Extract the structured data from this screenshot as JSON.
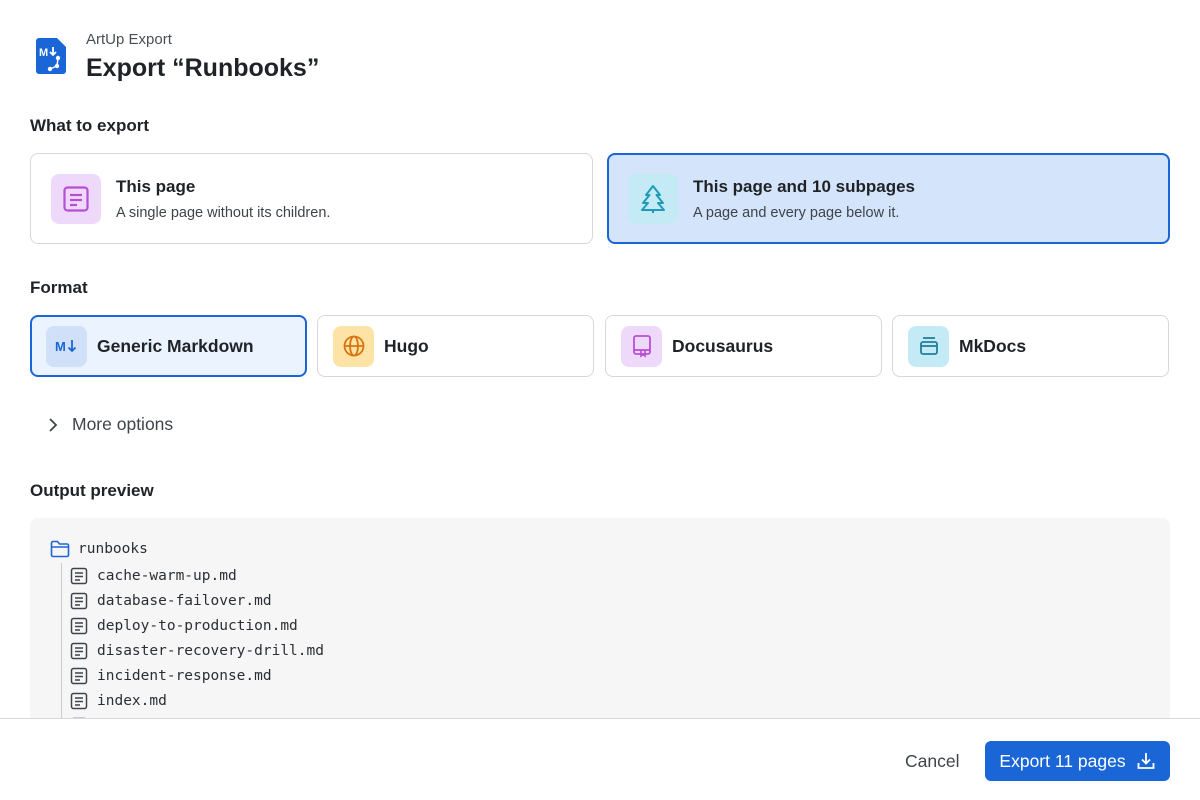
{
  "header": {
    "app_name": "ArtUp Export",
    "title": "Export “Runbooks”"
  },
  "sections": {
    "what_to_export": "What to export",
    "format": "Format",
    "output_preview": "Output preview"
  },
  "scope": {
    "options": [
      {
        "title": "This page",
        "description": "A single page without its children.",
        "icon": "document-icon",
        "selected": false
      },
      {
        "title": "This page and 10 subpages",
        "description": "A page and every page below it.",
        "icon": "tree-icon",
        "selected": true
      }
    ]
  },
  "format": {
    "options": [
      {
        "label": "Generic Markdown",
        "icon": "markdown-icon",
        "selected": true
      },
      {
        "label": "Hugo",
        "icon": "globe-icon",
        "selected": false
      },
      {
        "label": "Docusaurus",
        "icon": "book-icon",
        "selected": false
      },
      {
        "label": "MkDocs",
        "icon": "archive-icon",
        "selected": false
      }
    ]
  },
  "more_options": {
    "label": "More options",
    "expanded": false
  },
  "preview": {
    "root": "runbooks",
    "files": [
      "cache-warm-up.md",
      "database-failover.md",
      "deploy-to-production.md",
      "disaster-recovery-drill.md",
      "incident-response.md",
      "index.md"
    ]
  },
  "footer": {
    "cancel_label": "Cancel",
    "export_label": "Export 11 pages"
  },
  "colors": {
    "accent": "#1a66d6",
    "selected_bg": "#d4e4fa",
    "border": "#d5d8dc"
  }
}
